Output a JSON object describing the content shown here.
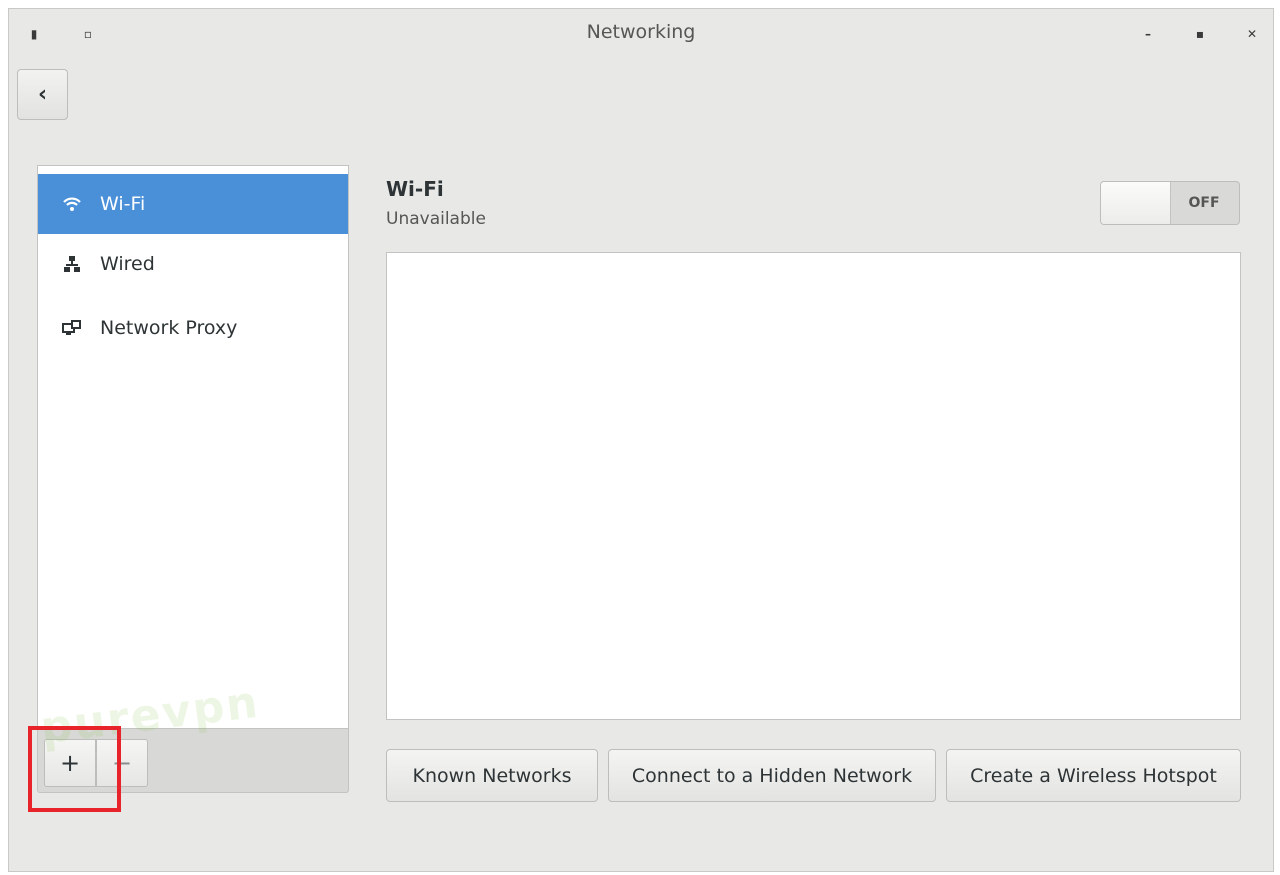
{
  "window": {
    "title": "Networking",
    "controls": {
      "minimize_icon": "minimize-icon",
      "maximize_icon": "maximize-icon",
      "close_icon": "close-icon"
    }
  },
  "header": {
    "back_icon": "chevron-left-icon"
  },
  "sidebar": {
    "items": [
      {
        "label": "Wi-Fi",
        "icon": "wifi-icon",
        "selected": true
      },
      {
        "label": "Wired",
        "icon": "wired-network-icon",
        "selected": false
      },
      {
        "label": "Network Proxy",
        "icon": "network-proxy-icon",
        "selected": false
      }
    ],
    "toolbar": {
      "add_label": "+",
      "remove_label": "−"
    }
  },
  "panel": {
    "title": "Wi-Fi",
    "status": "Unavailable",
    "toggle_state": "OFF",
    "buttons": {
      "known_networks": "Known Networks",
      "hidden_network": "Connect to a Hidden Network",
      "hotspot": "Create a Wireless Hotspot"
    }
  },
  "colors": {
    "selection": "#4a90d9",
    "highlight_box": "#e8232a",
    "window_bg": "#e8e8e7"
  },
  "watermark": "purevpn"
}
